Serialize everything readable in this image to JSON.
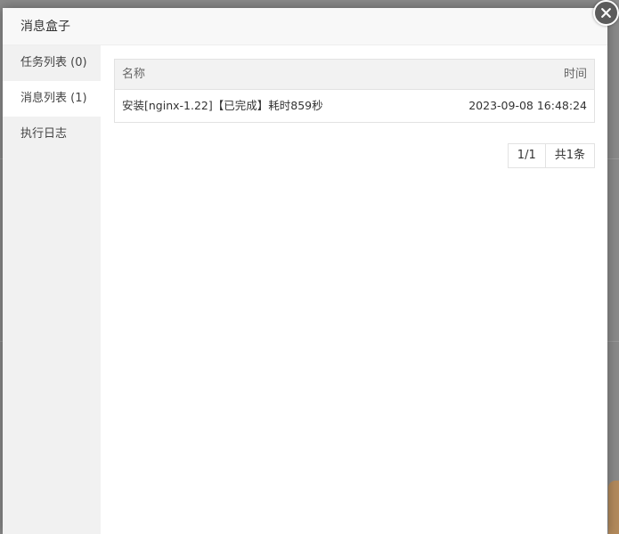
{
  "modal": {
    "title": "消息盒子"
  },
  "sidebar": {
    "items": [
      {
        "label": "任务列表 (0)"
      },
      {
        "label": "消息列表 (1)"
      },
      {
        "label": "执行日志"
      }
    ]
  },
  "table": {
    "headers": {
      "name": "名称",
      "time": "时间"
    },
    "rows": [
      {
        "name": "安装[nginx-1.22]【已完成】耗时859秒",
        "time": "2023-09-08 16:48:24"
      }
    ]
  },
  "pager": {
    "page": "1/1",
    "total": "共1条"
  },
  "icons": {
    "close": "close-icon"
  },
  "colors": {
    "close_bg": "#5c5c5c",
    "sidebar_bg": "#f1f1f1",
    "header_bg": "#f8f8f8"
  }
}
